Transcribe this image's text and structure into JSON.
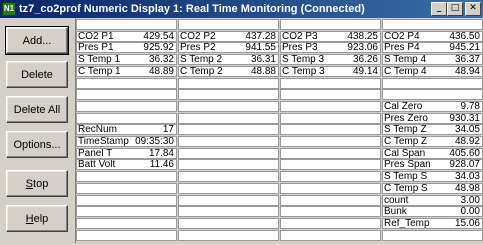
{
  "window": {
    "title": "tz7_co2prof Numeric Display 1: Real Time Monitoring (Connected)",
    "icon_text": "N1",
    "controls": {
      "minimize": "_",
      "maximize": "□",
      "close": "✕"
    }
  },
  "buttons": {
    "add": "Add...",
    "delete": "Delete",
    "delete_all": "Delete All",
    "options": "Options...",
    "stop": "Stop",
    "help": "Help"
  },
  "columns": [
    [
      {
        "label": "",
        "value": ""
      },
      {
        "label": "CO2  P1",
        "value": "429.54"
      },
      {
        "label": "Pres  P1",
        "value": "925.92"
      },
      {
        "label": "S  Temp  1",
        "value": "36.32"
      },
      {
        "label": "C  Temp  1",
        "value": "48.89"
      },
      {
        "label": "",
        "value": ""
      },
      {
        "label": "",
        "value": ""
      },
      {
        "label": "",
        "value": ""
      },
      {
        "label": "",
        "value": ""
      },
      {
        "label": "RecNum",
        "value": "17"
      },
      {
        "label": "TimeStamp",
        "value": "09:35:30"
      },
      {
        "label": "Panel  T",
        "value": "17.84"
      },
      {
        "label": "Batt  Volt",
        "value": "11.46"
      },
      {
        "label": "",
        "value": ""
      },
      {
        "label": "",
        "value": ""
      },
      {
        "label": "",
        "value": ""
      },
      {
        "label": "",
        "value": ""
      },
      {
        "label": "",
        "value": ""
      },
      {
        "label": "",
        "value": ""
      }
    ],
    [
      {
        "label": "",
        "value": ""
      },
      {
        "label": "CO2  P2",
        "value": "437.28"
      },
      {
        "label": "Pres  P2",
        "value": "941.55"
      },
      {
        "label": "S  Temp  2",
        "value": "36.31"
      },
      {
        "label": "C  Temp  2",
        "value": "48.88"
      },
      {
        "label": "",
        "value": ""
      },
      {
        "label": "",
        "value": ""
      },
      {
        "label": "",
        "value": ""
      },
      {
        "label": "",
        "value": ""
      },
      {
        "label": "",
        "value": ""
      },
      {
        "label": "",
        "value": ""
      },
      {
        "label": "",
        "value": ""
      },
      {
        "label": "",
        "value": ""
      },
      {
        "label": "",
        "value": ""
      },
      {
        "label": "",
        "value": ""
      },
      {
        "label": "",
        "value": ""
      },
      {
        "label": "",
        "value": ""
      },
      {
        "label": "",
        "value": ""
      },
      {
        "label": "",
        "value": ""
      }
    ],
    [
      {
        "label": "",
        "value": ""
      },
      {
        "label": "CO2  P3",
        "value": "438.25"
      },
      {
        "label": "Pres  P3",
        "value": "923.06"
      },
      {
        "label": "S  Temp  3",
        "value": "36.26"
      },
      {
        "label": "C  Temp  3",
        "value": "49.14"
      },
      {
        "label": "",
        "value": ""
      },
      {
        "label": "",
        "value": ""
      },
      {
        "label": "",
        "value": ""
      },
      {
        "label": "",
        "value": ""
      },
      {
        "label": "",
        "value": ""
      },
      {
        "label": "",
        "value": ""
      },
      {
        "label": "",
        "value": ""
      },
      {
        "label": "",
        "value": ""
      },
      {
        "label": "",
        "value": ""
      },
      {
        "label": "",
        "value": ""
      },
      {
        "label": "",
        "value": ""
      },
      {
        "label": "",
        "value": ""
      },
      {
        "label": "",
        "value": ""
      },
      {
        "label": "",
        "value": ""
      }
    ],
    [
      {
        "label": "",
        "value": ""
      },
      {
        "label": "CO2  P4",
        "value": "436.50"
      },
      {
        "label": "Pres  P4",
        "value": "945.21"
      },
      {
        "label": "S  Temp  4",
        "value": "36.37"
      },
      {
        "label": "C  Temp  4",
        "value": "48.94"
      },
      {
        "label": "",
        "value": ""
      },
      {
        "label": "",
        "value": ""
      },
      {
        "label": "Cal  Zero",
        "value": "9.78"
      },
      {
        "label": "Pres  Zero",
        "value": "930.31"
      },
      {
        "label": "S  Temp  Z",
        "value": "34.05"
      },
      {
        "label": "C  Temp  Z",
        "value": "48.92"
      },
      {
        "label": "Cal  Span",
        "value": "405.60"
      },
      {
        "label": "Pres  Span",
        "value": "928.07"
      },
      {
        "label": "S  Temp  S",
        "value": "34.03"
      },
      {
        "label": "C  Temp  S",
        "value": "48.98"
      },
      {
        "label": "count",
        "value": "3.00"
      },
      {
        "label": "Bunk",
        "value": "0.00"
      },
      {
        "label": "Ref_Temp",
        "value": "15.06"
      },
      {
        "label": "",
        "value": ""
      }
    ]
  ]
}
